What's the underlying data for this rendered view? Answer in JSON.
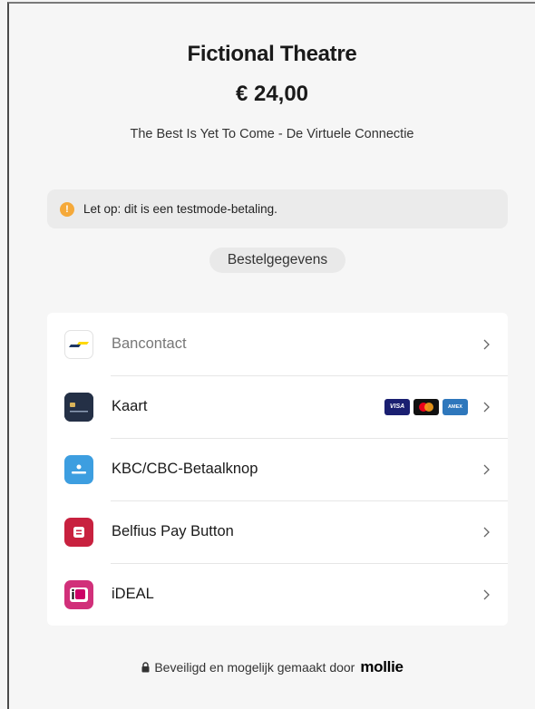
{
  "merchant": "Fictional Theatre",
  "amount": "€ 24,00",
  "description": "The Best Is Yet To Come - De Virtuele Connectie",
  "notice": {
    "text": "Let op: dit is een testmode-betaling.",
    "icon": "warning-icon",
    "color": "#f5a93a"
  },
  "order_button": "Bestelgegevens",
  "methods": [
    {
      "label": "Bancontact",
      "icon": "bancontact-icon"
    },
    {
      "label": "Kaart",
      "icon": "card-icon",
      "brands": [
        "VISA",
        "mastercard",
        "AMEX"
      ]
    },
    {
      "label": "KBC/CBC-Betaalknop",
      "icon": "kbc-icon"
    },
    {
      "label": "Belfius Pay Button",
      "icon": "belfius-icon"
    },
    {
      "label": "iDEAL",
      "icon": "ideal-icon"
    }
  ],
  "footer": {
    "text": "Beveiligd en mogelijk gemaakt door",
    "brand": "mollie"
  },
  "colors": {
    "kbc": "#3d9ee0",
    "belfius": "#c8213f",
    "ideal": "#cc0066",
    "visa": "#1a1f71",
    "amex": "#2e77bc"
  }
}
